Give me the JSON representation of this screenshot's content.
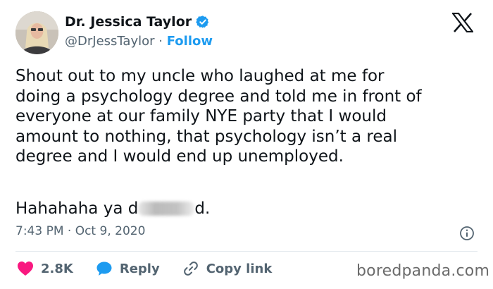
{
  "author": {
    "name": "Dr. Jessica Taylor",
    "handle": "@DrJessTaylor",
    "separator": "·",
    "follow_label": "Follow"
  },
  "tweet": {
    "body": "Shout out to my uncle who laughed at me for\ndoing a psychology degree and told me in front of\neveryone at our family NYE party that I would\namount to nothing, that psychology isn’t a real\ndegree and I would end up unemployed.",
    "closing_start": "Hahahaha ya d",
    "closing_end": "d."
  },
  "meta": {
    "timestamp": "7:43 PM · Oct 9, 2020"
  },
  "actions": {
    "likes": "2.8K",
    "reply_label": "Reply",
    "copy_label": "Copy link"
  },
  "watermark": "boredpanda.com",
  "colors": {
    "like": "#f91880",
    "reply": "#1d9bf0",
    "verified": "#1d9bf0",
    "follow": "#1d9bf0"
  },
  "icons": [
    "verified-badge-icon",
    "x-logo-icon",
    "info-icon",
    "heart-icon",
    "reply-bubble-icon",
    "link-icon"
  ]
}
